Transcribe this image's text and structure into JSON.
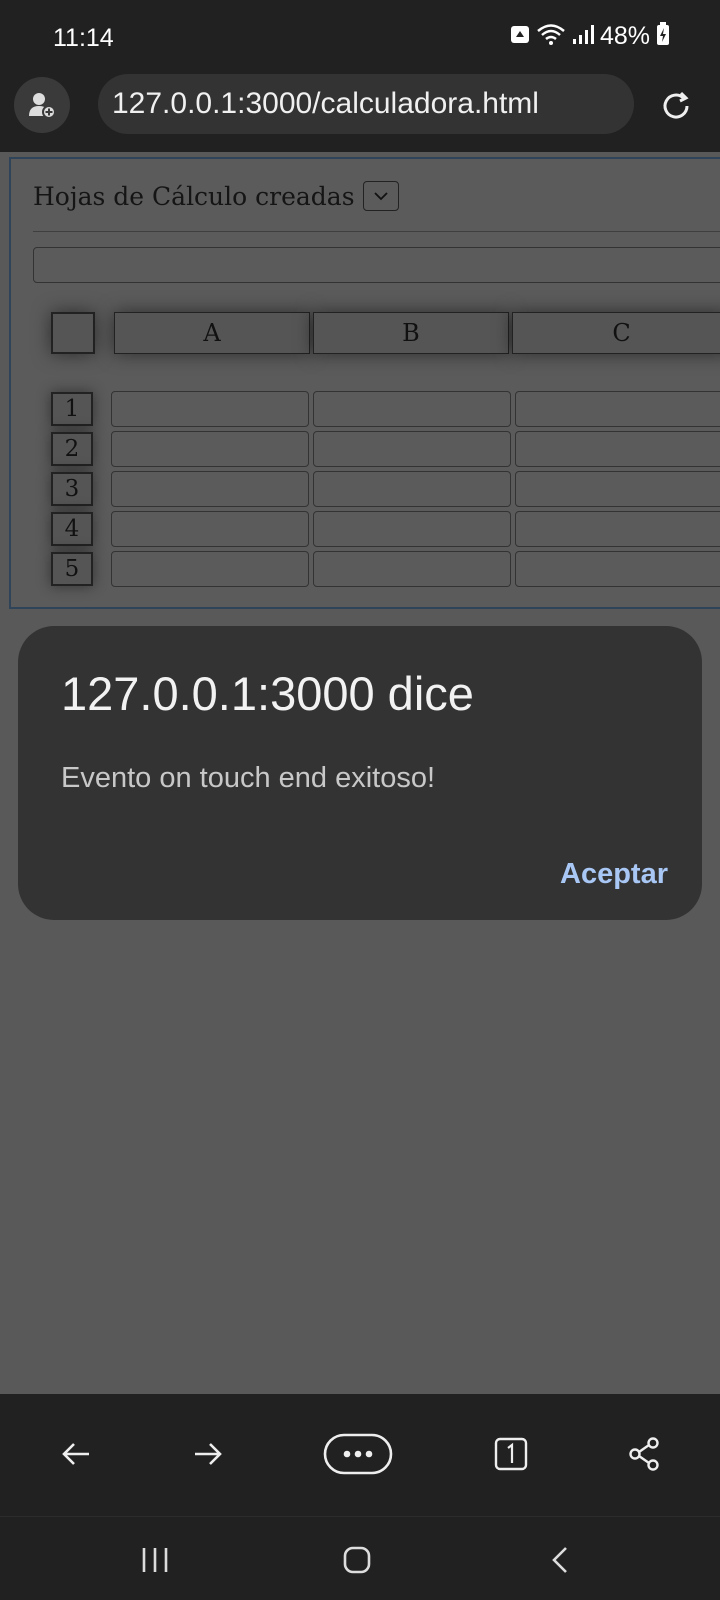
{
  "status_bar": {
    "time": "11:14",
    "battery": "48%",
    "icons": [
      "notification-icon",
      "wifi-icon",
      "signal-icon",
      "battery-charging-icon"
    ]
  },
  "browser": {
    "url": "127.0.0.1:3000/calculadora.html"
  },
  "spreadsheet": {
    "title": "Hojas de Cálculo creadas",
    "formula_value": "",
    "columns": [
      "A",
      "B",
      "C"
    ],
    "rows": [
      "1",
      "2",
      "3",
      "4",
      "5"
    ]
  },
  "dialog": {
    "title": "127.0.0.1:3000 dice",
    "message": "Evento on touch end exitoso!",
    "ok_label": "Aceptar"
  },
  "colors": {
    "accent": "#a9c7f5",
    "dialog_bg": "#333333",
    "chrome_bg": "#212121"
  }
}
